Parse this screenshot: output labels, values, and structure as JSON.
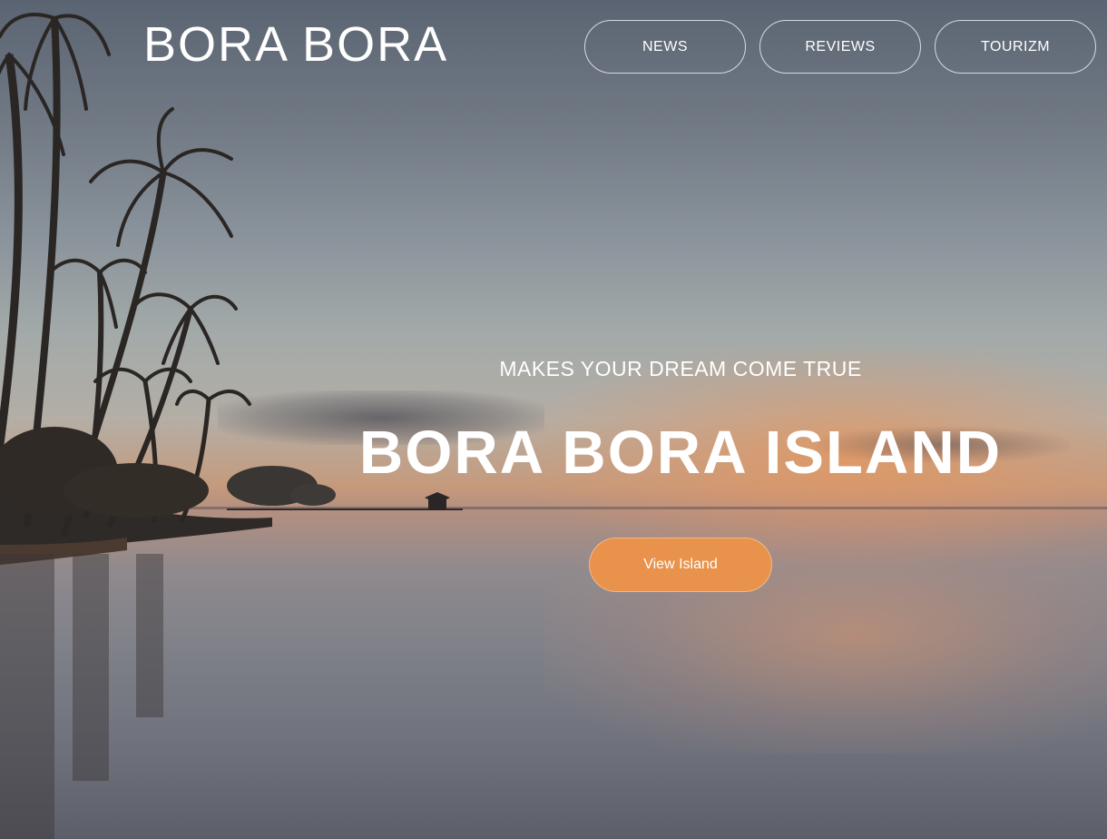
{
  "brand": {
    "logo_text": "BORA BORA"
  },
  "nav": {
    "items": [
      {
        "label": "NEWS"
      },
      {
        "label": "REVIEWS"
      },
      {
        "label": "TOURIZM"
      }
    ]
  },
  "hero": {
    "tagline": "MAKES YOUR DREAM COME TRUE",
    "title": "BORA BORA ISLAND",
    "cta_label": "View Island",
    "background_image": "tropical-sunset-beach-with-palm-trees"
  },
  "colors": {
    "accent": "#e9924c",
    "text": "#ffffff"
  }
}
